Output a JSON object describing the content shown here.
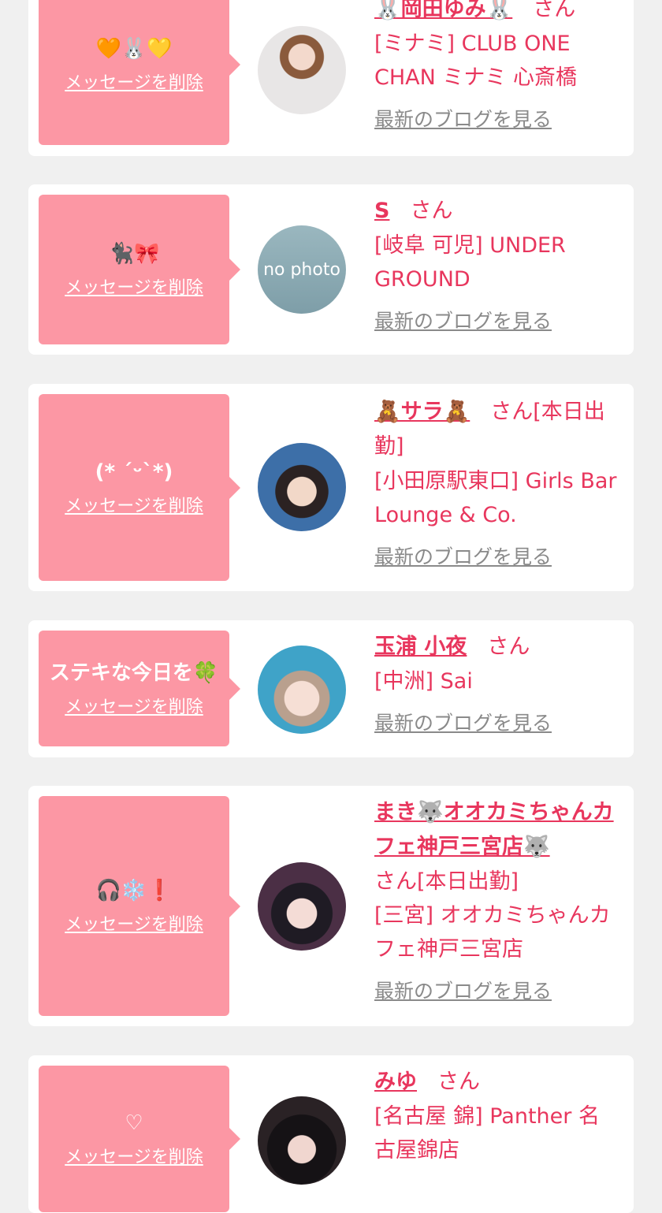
{
  "delete_label": "メッセージを削除",
  "blog_label": "最新のブログを見る",
  "items": [
    {
      "message": "🧡🐰💛",
      "name": "🐰岡田ゆみ🐰",
      "suffix": "さん",
      "shop": "[ミナミ] CLUB ONE CHAN ミナミ 心斎橋",
      "avatar": "photo-woman-white-dress"
    },
    {
      "message": "🐈‍⬛🎀",
      "name": "S",
      "suffix": "さん",
      "shop": "[岐阜 可児] UNDER GROUND",
      "avatar": "no-photo-placeholder",
      "avatar_text": "no photo"
    },
    {
      "message": "(* ´ᵕ`*)",
      "name": "🧸サラ🧸",
      "suffix": "さん[本日出勤]",
      "shop": "[小田原駅東口] Girls Bar Lounge & Co.",
      "avatar": "photo-woman-dark-hair"
    },
    {
      "message": "ステキな今日を🍀",
      "name": "玉浦 小夜",
      "suffix": "さん",
      "shop": "[中洲] Sai",
      "avatar": "photo-woman-sticker"
    },
    {
      "message": "🎧❄️❗️",
      "name": "まき🐺オオカミちゃんカフェ神戸三宮店🐺",
      "suffix": "さん[本日出勤]",
      "shop": "[三宮] オオカミちゃんカフェ神戸三宮店",
      "avatar": "photo-woman-bangs"
    },
    {
      "message": "♡",
      "name": "みゆ",
      "suffix": "さん",
      "shop": "[名古屋 錦] Panther 名古屋錦店",
      "avatar": "photo-woman-panther"
    }
  ]
}
